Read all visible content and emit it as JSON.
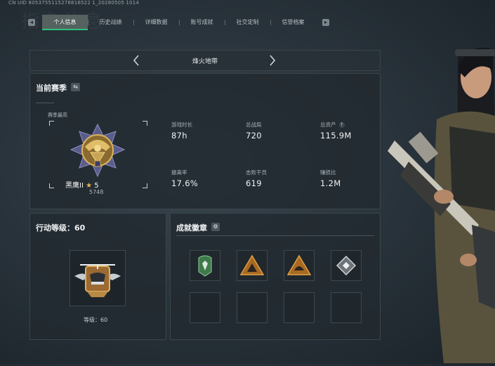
{
  "meta": {
    "uid": "CN UID 8053755115278816522 1_20280505 1014"
  },
  "watermark": "指名信息",
  "tabs": [
    {
      "label": "个人信息",
      "active": true
    },
    {
      "label": "历史战绩",
      "active": false
    },
    {
      "label": "详细数据",
      "active": false
    },
    {
      "label": "账号成就",
      "active": false
    },
    {
      "label": "社交定制",
      "active": false
    },
    {
      "label": "信誉档案",
      "active": false
    }
  ],
  "map_selector": {
    "title": "烽火地带",
    "prev_icon": "chevron-left-icon",
    "next_icon": "chevron-right-icon"
  },
  "season": {
    "title": "当前赛季",
    "best_label": "赛季最高",
    "rank_name": "黑鹰II",
    "rank_star": "★",
    "rank_stars": "5",
    "rank_score": "5748",
    "stats": [
      {
        "label": "游戏时长",
        "value": "87h"
      },
      {
        "label": "总战局",
        "value": "720"
      },
      {
        "label": "总资产",
        "value": "115.9M",
        "help": "?"
      },
      {
        "label": "撤离率",
        "value": "17.6%"
      },
      {
        "label": "击败干员",
        "value": "619"
      },
      {
        "label": "赚损比",
        "value": "1.2M"
      }
    ]
  },
  "action": {
    "title": "行动等级：60",
    "level_label": "等级：60"
  },
  "badges": {
    "title": "成就徽章",
    "slots_filled": 4,
    "slots_total": 8
  },
  "colors": {
    "accent": "#2ec07c",
    "gold": "#c9a455",
    "bg": "#2a343c"
  }
}
